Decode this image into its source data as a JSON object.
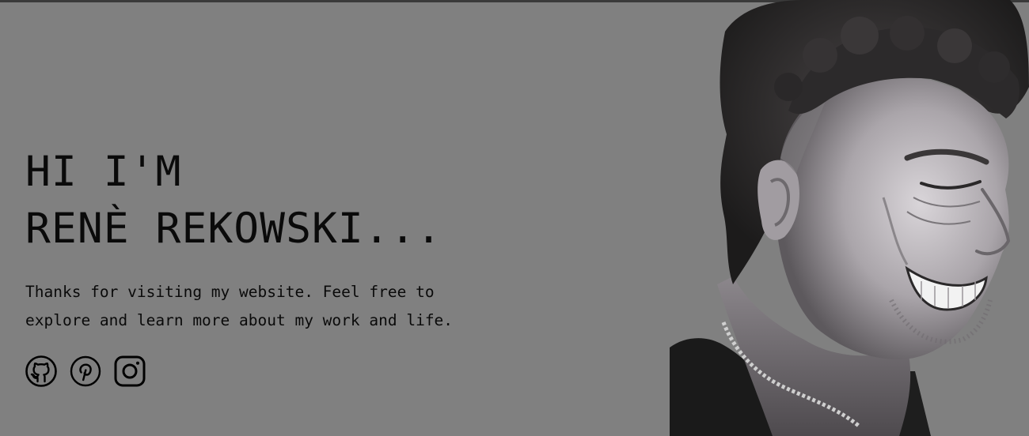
{
  "hero": {
    "headline_line1": "HI I'M",
    "headline_line2": "RENÈ REKOWSKI...",
    "bio": "Thanks for visiting my website. Feel free to explore and learn more about my work and life."
  },
  "socials": [
    {
      "name": "GitHub",
      "icon": "github-icon"
    },
    {
      "name": "Pinterest",
      "icon": "pinterest-icon"
    },
    {
      "name": "Instagram",
      "icon": "instagram-icon"
    }
  ],
  "colors": {
    "background": "#808080",
    "text": "#0a0a0a",
    "topbar": "#3a3a3a"
  }
}
